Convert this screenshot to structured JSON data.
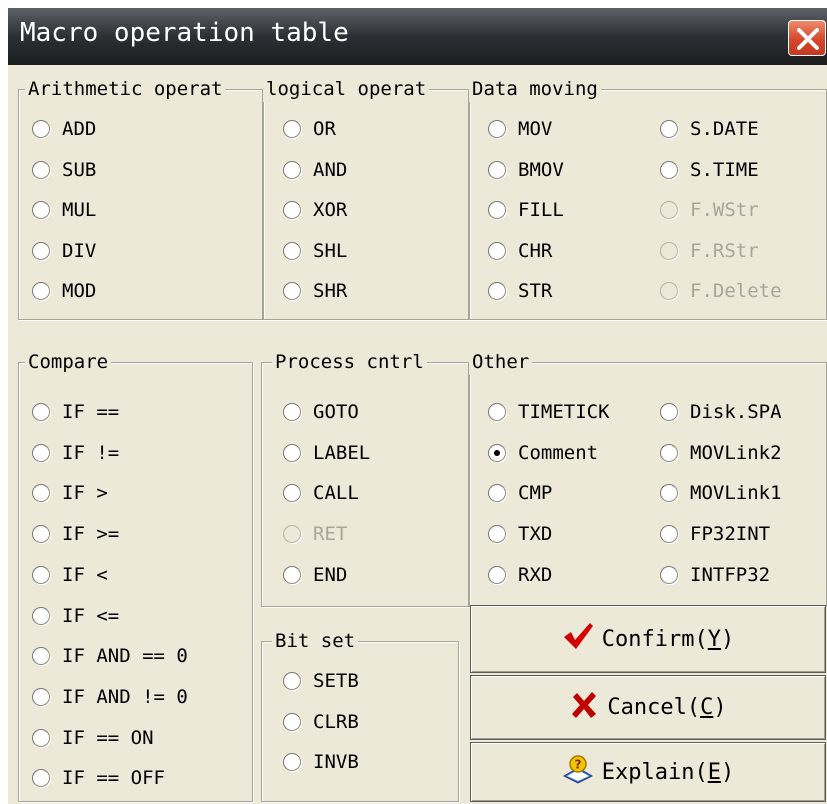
{
  "window": {
    "title": "Macro operation table",
    "close_icon": "close-x-icon"
  },
  "groups": {
    "arithmetic": {
      "title": "Arithmetic operat",
      "options": [
        {
          "label": "ADD",
          "checked": false,
          "enabled": true
        },
        {
          "label": "SUB",
          "checked": false,
          "enabled": true
        },
        {
          "label": "MUL",
          "checked": false,
          "enabled": true
        },
        {
          "label": "DIV",
          "checked": false,
          "enabled": true
        },
        {
          "label": "MOD",
          "checked": false,
          "enabled": true
        }
      ]
    },
    "logical": {
      "title": "logical operat",
      "options": [
        {
          "label": "OR",
          "checked": false,
          "enabled": true
        },
        {
          "label": "AND",
          "checked": false,
          "enabled": true
        },
        {
          "label": "XOR",
          "checked": false,
          "enabled": true
        },
        {
          "label": "SHL",
          "checked": false,
          "enabled": true
        },
        {
          "label": "SHR",
          "checked": false,
          "enabled": true
        }
      ]
    },
    "data_moving": {
      "title": "Data moving",
      "options": [
        {
          "label": "MOV",
          "checked": false,
          "enabled": true
        },
        {
          "label": "BMOV",
          "checked": false,
          "enabled": true
        },
        {
          "label": "FILL",
          "checked": false,
          "enabled": true
        },
        {
          "label": "CHR",
          "checked": false,
          "enabled": true
        },
        {
          "label": "STR",
          "checked": false,
          "enabled": true
        },
        {
          "label": "S.DATE",
          "checked": false,
          "enabled": true
        },
        {
          "label": "S.TIME",
          "checked": false,
          "enabled": true
        },
        {
          "label": "F.WStr",
          "checked": false,
          "enabled": false
        },
        {
          "label": "F.RStr",
          "checked": false,
          "enabled": false
        },
        {
          "label": "F.Delete",
          "checked": false,
          "enabled": false
        }
      ]
    },
    "compare": {
      "title": "Compare",
      "options": [
        {
          "label": "IF ==",
          "checked": false,
          "enabled": true
        },
        {
          "label": "IF !=",
          "checked": false,
          "enabled": true
        },
        {
          "label": "IF >",
          "checked": false,
          "enabled": true
        },
        {
          "label": "IF >=",
          "checked": false,
          "enabled": true
        },
        {
          "label": "IF <",
          "checked": false,
          "enabled": true
        },
        {
          "label": "IF <=",
          "checked": false,
          "enabled": true
        },
        {
          "label": "IF AND == 0",
          "checked": false,
          "enabled": true
        },
        {
          "label": "IF AND != 0",
          "checked": false,
          "enabled": true
        },
        {
          "label": "IF == ON",
          "checked": false,
          "enabled": true
        },
        {
          "label": "IF == OFF",
          "checked": false,
          "enabled": true
        }
      ]
    },
    "process": {
      "title": "Process cntrl",
      "options": [
        {
          "label": "GOTO",
          "checked": false,
          "enabled": true
        },
        {
          "label": "LABEL",
          "checked": false,
          "enabled": true
        },
        {
          "label": "CALL",
          "checked": false,
          "enabled": true
        },
        {
          "label": "RET",
          "checked": false,
          "enabled": false
        },
        {
          "label": "END",
          "checked": false,
          "enabled": true
        }
      ]
    },
    "other": {
      "title": "Other",
      "options": [
        {
          "label": "TIMETICK",
          "checked": false,
          "enabled": true
        },
        {
          "label": "Comment",
          "checked": true,
          "enabled": true
        },
        {
          "label": "CMP",
          "checked": false,
          "enabled": true
        },
        {
          "label": "TXD",
          "checked": false,
          "enabled": true
        },
        {
          "label": "RXD",
          "checked": false,
          "enabled": true
        },
        {
          "label": "Disk.SPA",
          "checked": false,
          "enabled": true
        },
        {
          "label": "MOVLink2",
          "checked": false,
          "enabled": true
        },
        {
          "label": "MOVLink1",
          "checked": false,
          "enabled": true
        },
        {
          "label": "FP32INT",
          "checked": false,
          "enabled": true
        },
        {
          "label": "INTFP32",
          "checked": false,
          "enabled": true
        }
      ]
    },
    "bitset": {
      "title": "Bit set",
      "options": [
        {
          "label": "SETB",
          "checked": false,
          "enabled": true
        },
        {
          "label": "CLRB",
          "checked": false,
          "enabled": true
        },
        {
          "label": "INVB",
          "checked": false,
          "enabled": true
        }
      ]
    }
  },
  "buttons": {
    "confirm": {
      "label": "Confirm(",
      "mnemonic": "Y",
      "close": ")",
      "icon": "checkmark-icon",
      "icon_color": "#d40000"
    },
    "cancel": {
      "label": "Cancel(",
      "mnemonic": "C",
      "close": ")",
      "icon": "x-cross-icon",
      "icon_color": "#c00000"
    },
    "explain": {
      "label": "Explain(",
      "mnemonic": "E",
      "close": ")",
      "icon": "help-book-icon",
      "icon_color": "#d9a400"
    }
  }
}
